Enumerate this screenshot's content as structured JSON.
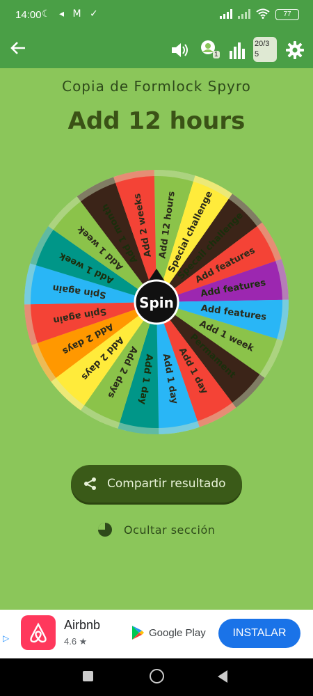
{
  "status": {
    "time": "14:00",
    "battery": "77",
    "left_icons": "☾ ◂ M ✓"
  },
  "app_bar": {
    "users_count": "1",
    "counter_line1": "20/3",
    "counter_line2": "5"
  },
  "wheel": {
    "title": "Copia de Formlock Spyro",
    "result": "Add 12 hours",
    "center_label": "Spin",
    "segments": [
      {
        "label": "Add 12 hours",
        "color": "#8bc34a"
      },
      {
        "label": "Special challenge",
        "color": "#ffeb3b"
      },
      {
        "label": "Specail challenge",
        "color": "#3b2418"
      },
      {
        "label": "Add features",
        "color": "#f44336"
      },
      {
        "label": "Add features",
        "color": "#9c27b0"
      },
      {
        "label": "Add features",
        "color": "#29b6f6"
      },
      {
        "label": "Add 1 week",
        "color": "#8bc34a"
      },
      {
        "label": "Permament",
        "color": "#3b2418"
      },
      {
        "label": "Add 1 day",
        "color": "#f44336"
      },
      {
        "label": "Add 1 day",
        "color": "#29b6f6"
      },
      {
        "label": "Add 1 day",
        "color": "#009688"
      },
      {
        "label": "Add 2 days",
        "color": "#8bc34a"
      },
      {
        "label": "Add 2 days",
        "color": "#ffeb3b"
      },
      {
        "label": "Add 2 days",
        "color": "#ff9800"
      },
      {
        "label": "Spin again",
        "color": "#f44336"
      },
      {
        "label": "Spin again",
        "color": "#29b6f6"
      },
      {
        "label": "Add 1 week",
        "color": "#009688"
      },
      {
        "label": "Add 1 week",
        "color": "#8bc34a"
      },
      {
        "label": "Add 1 month",
        "color": "#3b2418"
      },
      {
        "label": "Add 2 weeks",
        "color": "#f44336"
      }
    ]
  },
  "actions": {
    "share_label": "Compartir resultado",
    "hide_label": "Ocultar sección"
  },
  "ad": {
    "app_name": "Airbnb",
    "rating": "4.6 ★",
    "store": "Google Play",
    "install": "INSTALAR"
  }
}
